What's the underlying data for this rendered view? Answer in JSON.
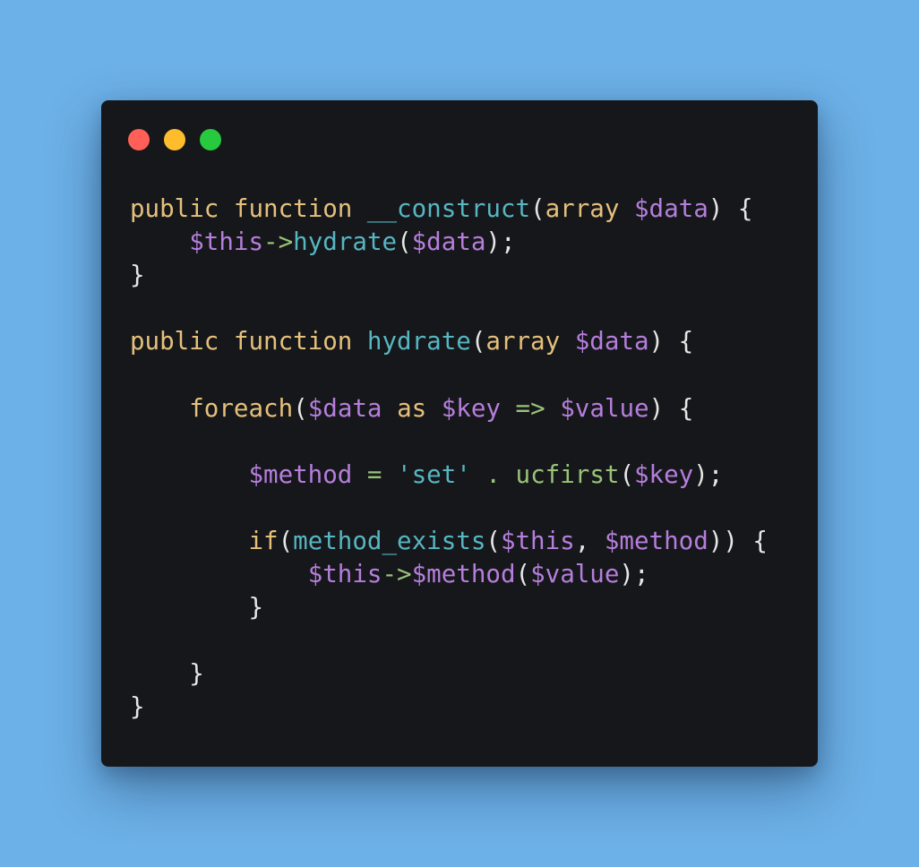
{
  "window": {
    "controls": [
      {
        "name": "close",
        "color": "#ff5f56"
      },
      {
        "name": "minimize",
        "color": "#ffbd2e"
      },
      {
        "name": "maximize",
        "color": "#27c93f"
      }
    ]
  },
  "code": {
    "lines": [
      [
        {
          "t": "kw",
          "v": "public"
        },
        {
          "t": "pn",
          "v": " "
        },
        {
          "t": "kw",
          "v": "function"
        },
        {
          "t": "pn",
          "v": " "
        },
        {
          "t": "fn",
          "v": "__construct"
        },
        {
          "t": "pn",
          "v": "("
        },
        {
          "t": "kw",
          "v": "array"
        },
        {
          "t": "pn",
          "v": " "
        },
        {
          "t": "var",
          "v": "$data"
        },
        {
          "t": "pn",
          "v": ") {"
        }
      ],
      [
        {
          "t": "pn",
          "v": "    "
        },
        {
          "t": "var",
          "v": "$this"
        },
        {
          "t": "op",
          "v": "->"
        },
        {
          "t": "fn",
          "v": "hydrate"
        },
        {
          "t": "pn",
          "v": "("
        },
        {
          "t": "var",
          "v": "$data"
        },
        {
          "t": "pn",
          "v": ");"
        }
      ],
      [
        {
          "t": "pn",
          "v": "}"
        }
      ],
      [],
      [
        {
          "t": "kw",
          "v": "public"
        },
        {
          "t": "pn",
          "v": " "
        },
        {
          "t": "kw",
          "v": "function"
        },
        {
          "t": "pn",
          "v": " "
        },
        {
          "t": "fn",
          "v": "hydrate"
        },
        {
          "t": "pn",
          "v": "("
        },
        {
          "t": "kw",
          "v": "array"
        },
        {
          "t": "pn",
          "v": " "
        },
        {
          "t": "var",
          "v": "$data"
        },
        {
          "t": "pn",
          "v": ") {"
        }
      ],
      [],
      [
        {
          "t": "pn",
          "v": "    "
        },
        {
          "t": "kw",
          "v": "foreach"
        },
        {
          "t": "pn",
          "v": "("
        },
        {
          "t": "var",
          "v": "$data"
        },
        {
          "t": "pn",
          "v": " "
        },
        {
          "t": "kw",
          "v": "as"
        },
        {
          "t": "pn",
          "v": " "
        },
        {
          "t": "var",
          "v": "$key"
        },
        {
          "t": "pn",
          "v": " "
        },
        {
          "t": "op",
          "v": "=>"
        },
        {
          "t": "pn",
          "v": " "
        },
        {
          "t": "var",
          "v": "$value"
        },
        {
          "t": "pn",
          "v": ") {"
        }
      ],
      [],
      [
        {
          "t": "pn",
          "v": "        "
        },
        {
          "t": "var",
          "v": "$method"
        },
        {
          "t": "pn",
          "v": " "
        },
        {
          "t": "op",
          "v": "="
        },
        {
          "t": "pn",
          "v": " "
        },
        {
          "t": "str",
          "v": "'set'"
        },
        {
          "t": "pn",
          "v": " "
        },
        {
          "t": "op",
          "v": "."
        },
        {
          "t": "pn",
          "v": " "
        },
        {
          "t": "op",
          "v": "ucfirst"
        },
        {
          "t": "pn",
          "v": "("
        },
        {
          "t": "var",
          "v": "$key"
        },
        {
          "t": "pn",
          "v": ");"
        }
      ],
      [],
      [
        {
          "t": "pn",
          "v": "        "
        },
        {
          "t": "kw",
          "v": "if"
        },
        {
          "t": "pn",
          "v": "("
        },
        {
          "t": "fn",
          "v": "method_exists"
        },
        {
          "t": "pn",
          "v": "("
        },
        {
          "t": "var",
          "v": "$this"
        },
        {
          "t": "pn",
          "v": ", "
        },
        {
          "t": "var",
          "v": "$method"
        },
        {
          "t": "pn",
          "v": ")) {"
        }
      ],
      [
        {
          "t": "pn",
          "v": "            "
        },
        {
          "t": "var",
          "v": "$this"
        },
        {
          "t": "op",
          "v": "->"
        },
        {
          "t": "var",
          "v": "$method"
        },
        {
          "t": "pn",
          "v": "("
        },
        {
          "t": "var",
          "v": "$value"
        },
        {
          "t": "pn",
          "v": ");"
        }
      ],
      [
        {
          "t": "pn",
          "v": "        }"
        }
      ],
      [],
      [
        {
          "t": "pn",
          "v": "    }"
        }
      ],
      [
        {
          "t": "pn",
          "v": "}"
        }
      ]
    ]
  }
}
